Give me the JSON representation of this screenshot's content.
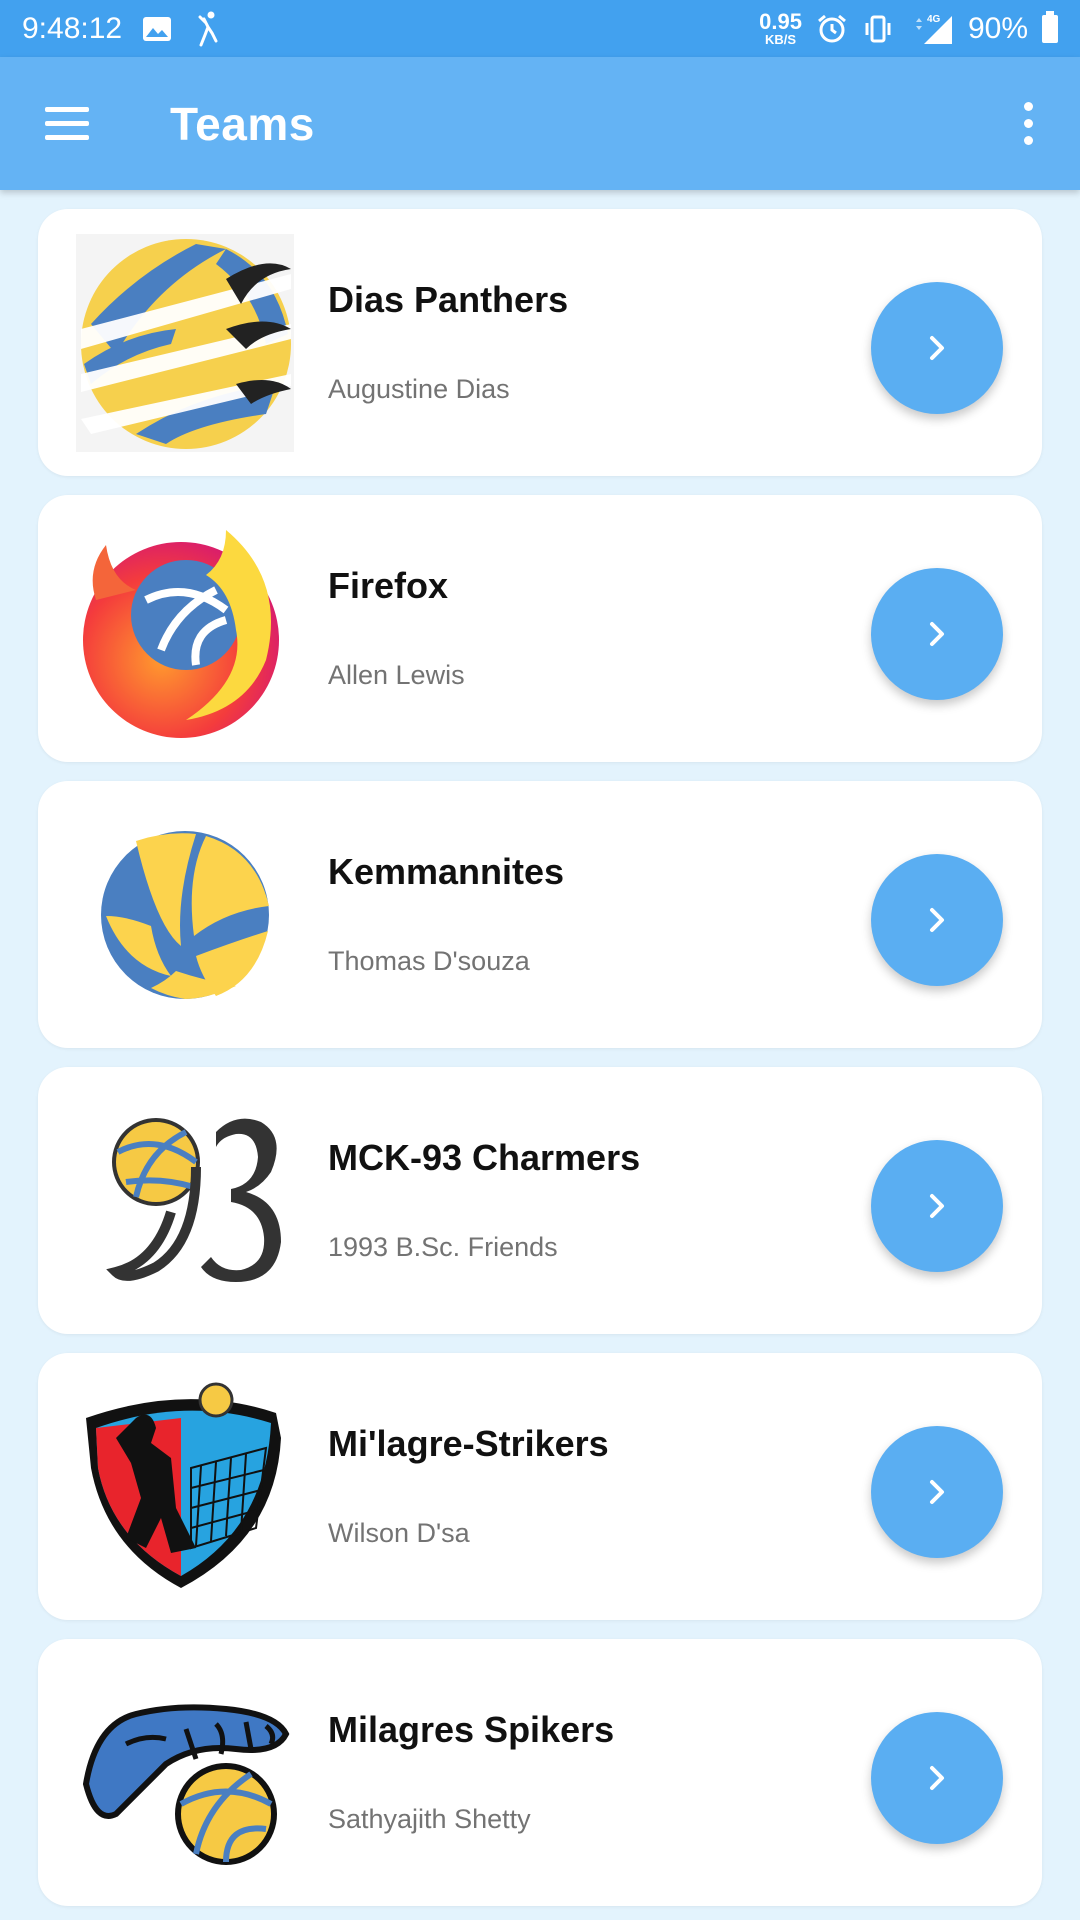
{
  "status_bar": {
    "time": "9:48:12",
    "speed_value": "0.95",
    "speed_unit": "KB/S",
    "network": "4G",
    "battery": "90%"
  },
  "app_bar": {
    "title": "Teams"
  },
  "teams": [
    {
      "name": "Dias Panthers",
      "owner": "Augustine Dias"
    },
    {
      "name": "Firefox",
      "owner": "Allen Lewis"
    },
    {
      "name": "Kemmannites",
      "owner": "Thomas D'souza"
    },
    {
      "name": "MCK-93 Charmers",
      "owner": "1993 B.Sc. Friends"
    },
    {
      "name": "Mi'lagre-Strikers",
      "owner": "Wilson D'sa"
    },
    {
      "name": "Milagres Spikers",
      "owner": "Sathyajith Shetty"
    }
  ],
  "colors": {
    "status_bar": "#42a1ef",
    "app_bar": "#64b3f4",
    "background": "#e3f3fd",
    "fab": "#5aaef2"
  }
}
